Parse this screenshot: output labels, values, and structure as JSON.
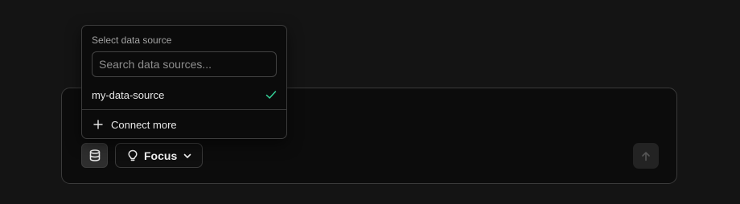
{
  "popover": {
    "title": "Select data source",
    "search_placeholder": "Search data sources...",
    "options": [
      {
        "label": "my-data-source",
        "selected": true
      }
    ],
    "connect_label": "Connect more"
  },
  "toolbar": {
    "focus_label": "Focus"
  },
  "icons": {
    "database": "database-icon",
    "check": "check-icon",
    "plus": "plus-icon",
    "lightbulb": "lightbulb-icon",
    "chevron": "chevron-down-icon",
    "send": "arrow-up-icon"
  },
  "colors": {
    "background": "#141414",
    "accent_check": "#34d399",
    "border": "#3a3a3a"
  }
}
